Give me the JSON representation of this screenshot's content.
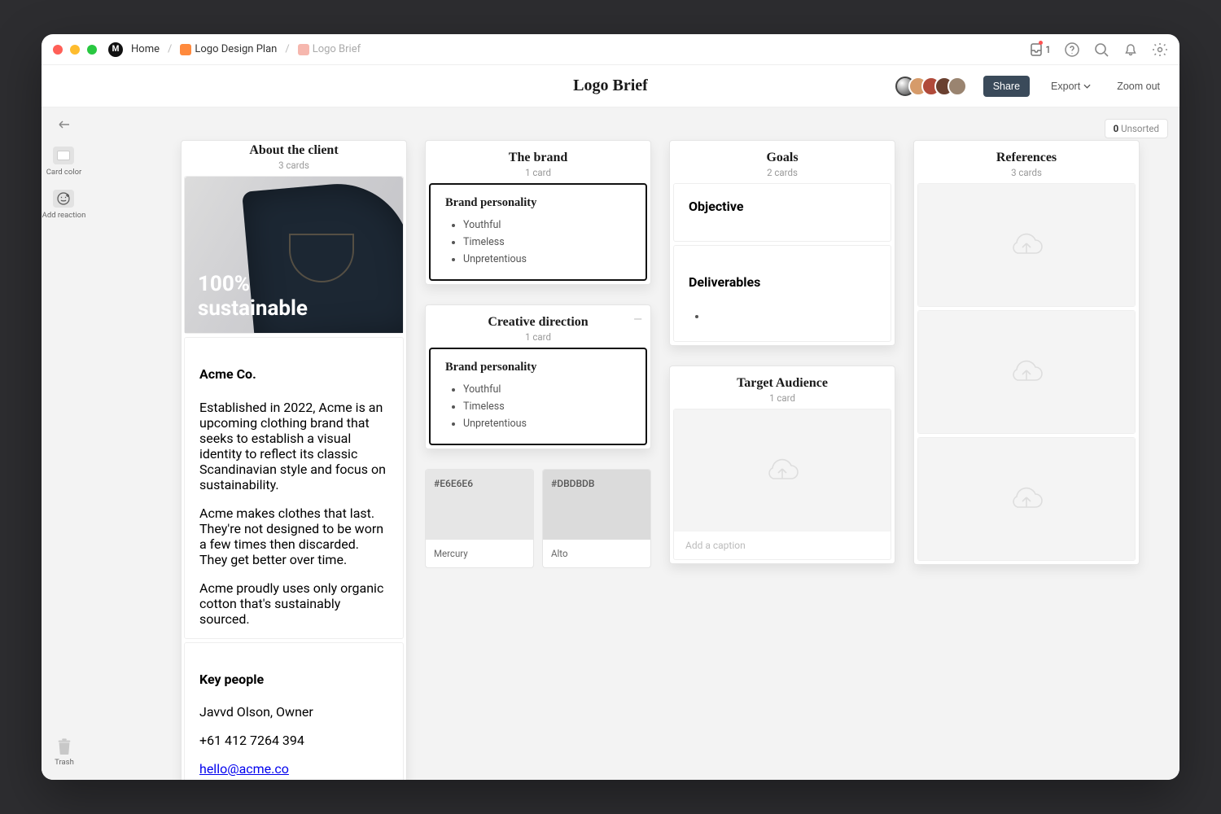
{
  "titlebar": {
    "home": "Home",
    "plan": "Logo Design Plan",
    "brief": "Logo Brief",
    "plan_color": "#ff8a3d",
    "brief_color": "#f6b7ae",
    "inbox_count": "1"
  },
  "header": {
    "title": "Logo Brief",
    "share": "Share",
    "export": "Export",
    "zoom": "Zoom out"
  },
  "sidebar": {
    "card_color": "Card color",
    "add_reaction": "Add reaction",
    "trash": "Trash"
  },
  "unsorted": {
    "count": "0",
    "label": "Unsorted"
  },
  "columns": [
    {
      "title": "About the client",
      "count": "3 cards",
      "hero_text": "100%\nsustainable",
      "company": "Acme Co.",
      "p1": "Established in 2022, Acme is an upcoming clothing brand that seeks to establish a visual identity to reflect its classic Scandinavian style and focus on sustainability.",
      "p2": "Acme makes clothes that last. They're not designed to be worn a few times then discarded. They get better over time.",
      "p3": "Acme proudly uses only organic cotton that's sustainably sourced.",
      "key_people_h": "Key people",
      "kp1": "Javvd Olson, Owner",
      "kp2": "+61 412 7264 394",
      "kp3": "hello@acme.co"
    },
    {
      "brand": {
        "title": "The brand",
        "count": "1 card",
        "card_h": "Brand personality",
        "b1": "Youthful",
        "b2": "Timeless",
        "b3": "Unpretentious"
      },
      "creative": {
        "title": "Creative direction",
        "count": "1 card",
        "card_h": "Brand personality",
        "b1": "Youthful",
        "b2": "Timeless",
        "b3": "Unpretentious"
      },
      "swatch1": {
        "hex": "#E6E6E6",
        "name": "Mercury"
      },
      "swatch2": {
        "hex": "#DBDBDB",
        "name": "Alto"
      }
    },
    {
      "goals": {
        "title": "Goals",
        "count": "2 cards",
        "c1": "Objective",
        "c2": "Deliverables"
      },
      "audience": {
        "title": "Target Audience",
        "count": "1 card",
        "caption_ph": "Add a caption"
      }
    },
    {
      "refs": {
        "title": "References",
        "count": "3 cards"
      }
    }
  ]
}
